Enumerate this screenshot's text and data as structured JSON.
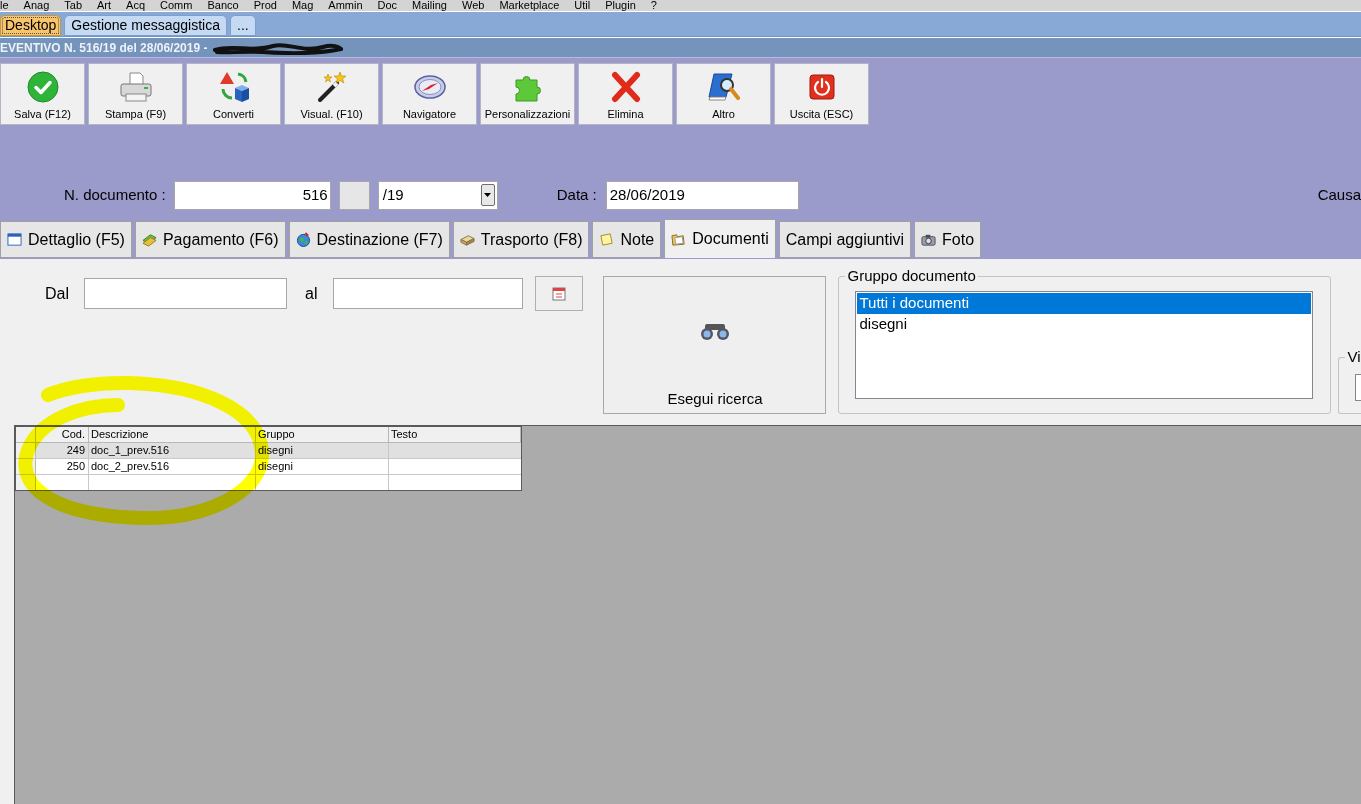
{
  "menu_bar": [
    "le",
    "Anag",
    "Tab",
    "Art",
    "Acq",
    "Comm",
    "Banco",
    "Prod",
    "Mag",
    "Ammin",
    "Doc",
    "Mailing",
    "Web",
    "Marketplace",
    "Util",
    "Plugin",
    "?"
  ],
  "desktop_tabs": [
    {
      "label": "Desktop",
      "selected": true
    },
    {
      "label": "Gestione messaggistica",
      "selected": false
    },
    {
      "label": "...",
      "selected": false
    }
  ],
  "document_title": "EVENTIVO N. 516/19 del 28/06/2019 -",
  "toolbar": [
    {
      "label": "Salva (F12)"
    },
    {
      "label": "Stampa (F9)"
    },
    {
      "label": "Converti"
    },
    {
      "label": "Visual. (F10)"
    },
    {
      "label": "Navigatore"
    },
    {
      "label": "Personalizzazioni"
    },
    {
      "label": "Elimina"
    },
    {
      "label": "Altro"
    },
    {
      "label": "Uscita (ESC)"
    }
  ],
  "header_fields": {
    "number_label": "N. documento :",
    "number_value": "516",
    "series_value": "/19",
    "date_label": "Data :",
    "date_value": "28/06/2019",
    "reason_label": "Causa"
  },
  "tabs": [
    {
      "label": "Dettaglio (F5)",
      "selected": false
    },
    {
      "label": "Pagamento (F6)",
      "selected": false
    },
    {
      "label": "Destinazione (F7)",
      "selected": false
    },
    {
      "label": "Trasporto (F8)",
      "selected": false
    },
    {
      "label": "Note",
      "selected": false
    },
    {
      "label": "Documenti",
      "selected": true
    },
    {
      "label": "Campi aggiuntivi",
      "selected": false
    },
    {
      "label": "Foto",
      "selected": false
    }
  ],
  "filters": {
    "from_label": "Dal",
    "to_label": "al",
    "search_button": "Esegui ricerca"
  },
  "group_box": {
    "title": "Gruppo documento",
    "items": [
      {
        "label": "Tutti i documenti",
        "selected": true
      },
      {
        "label": "disegni",
        "selected": false
      }
    ]
  },
  "side_box": {
    "title": "Vi"
  },
  "table": {
    "columns": [
      "Cod.",
      "Descrizione",
      "Gruppo",
      "Testo"
    ],
    "rows": [
      {
        "cod": "249",
        "descrizione": "doc_1_prev.516",
        "gruppo": "disegni",
        "selected": true
      },
      {
        "cod": "250",
        "descrizione": "doc_2_prev.516",
        "gruppo": "disegni",
        "selected": false
      }
    ]
  }
}
